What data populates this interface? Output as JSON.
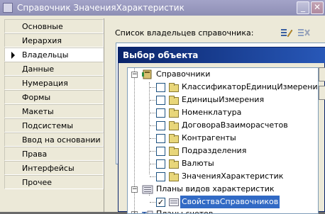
{
  "window": {
    "title": "Справочник ЗначенияХарактеристик"
  },
  "nav": {
    "items": [
      {
        "label": "Основные"
      },
      {
        "label": "Иерархия"
      },
      {
        "label": "Владельцы"
      },
      {
        "label": "Данные"
      },
      {
        "label": "Нумерация"
      },
      {
        "label": "Формы"
      },
      {
        "label": "Макеты"
      },
      {
        "label": "Подсистемы"
      },
      {
        "label": "Ввод на основании"
      },
      {
        "label": "Права"
      },
      {
        "label": "Интерфейсы"
      },
      {
        "label": "Прочее"
      }
    ],
    "active_index": 2
  },
  "main": {
    "list_label": "Список владельцев справочника:"
  },
  "dialog": {
    "title": "Выбор объекта",
    "tree": {
      "root": "Справочники",
      "items": [
        {
          "label": "КлассификаторЕдиницИзмерения",
          "checked": false
        },
        {
          "label": "ЕдиницыИзмерения",
          "checked": false
        },
        {
          "label": "Номенклатура",
          "checked": false
        },
        {
          "label": "ДоговораВзаиморасчетов",
          "checked": false
        },
        {
          "label": "Контрагенты",
          "checked": false
        },
        {
          "label": "Подразделения",
          "checked": false
        },
        {
          "label": "Валюты",
          "checked": false
        },
        {
          "label": "ЗначенияХарактеристик",
          "checked": false
        }
      ],
      "root2": "Планы видов характеристик",
      "items2": [
        {
          "label": "СвойстваСправочников",
          "checked": true
        }
      ],
      "root3": "Планы счетов"
    }
  },
  "colors": {
    "title_inactive": "#9a9bc0",
    "title_active": "#0a246a",
    "selection": "#316ac5",
    "face": "#ece9d8"
  }
}
